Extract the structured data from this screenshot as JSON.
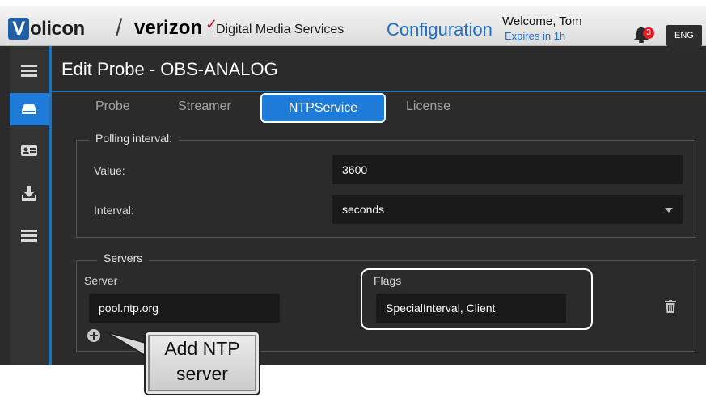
{
  "header": {
    "brand_letter": "V",
    "brand_rest": "olicon",
    "partner": "verizon",
    "product": "Digital Media Services",
    "section": "Configuration",
    "welcome": "Welcome, Tom",
    "expires": "Expires in 1h",
    "notification_count": "3",
    "language": "ENG"
  },
  "sidebar": {
    "items": [
      {
        "icon": "menu-icon"
      },
      {
        "icon": "drive-icon",
        "active": true
      },
      {
        "icon": "id-card-icon"
      },
      {
        "icon": "download-icon"
      },
      {
        "icon": "list-icon"
      }
    ]
  },
  "page": {
    "title": "Edit Probe - OBS-ANALOG",
    "tabs": [
      {
        "label": "Probe"
      },
      {
        "label": "Streamer"
      },
      {
        "label": "NTPService",
        "active": true
      },
      {
        "label": "License"
      }
    ]
  },
  "polling": {
    "legend": "Polling interval:",
    "value_label": "Value:",
    "value": "3600",
    "interval_label": "Interval:",
    "interval": "seconds"
  },
  "servers": {
    "legend": "Servers",
    "server_header": "Server",
    "flags_header": "Flags",
    "rows": [
      {
        "server": "pool.ntp.org",
        "flags": "SpecialInterval, Client"
      }
    ]
  },
  "callout": {
    "line1": "Add NTP",
    "line2": "server"
  },
  "colors": {
    "accent": "#1f7bd8",
    "background": "#2b2b2b",
    "input": "#1a1a1a",
    "badge": "#e41b23"
  }
}
